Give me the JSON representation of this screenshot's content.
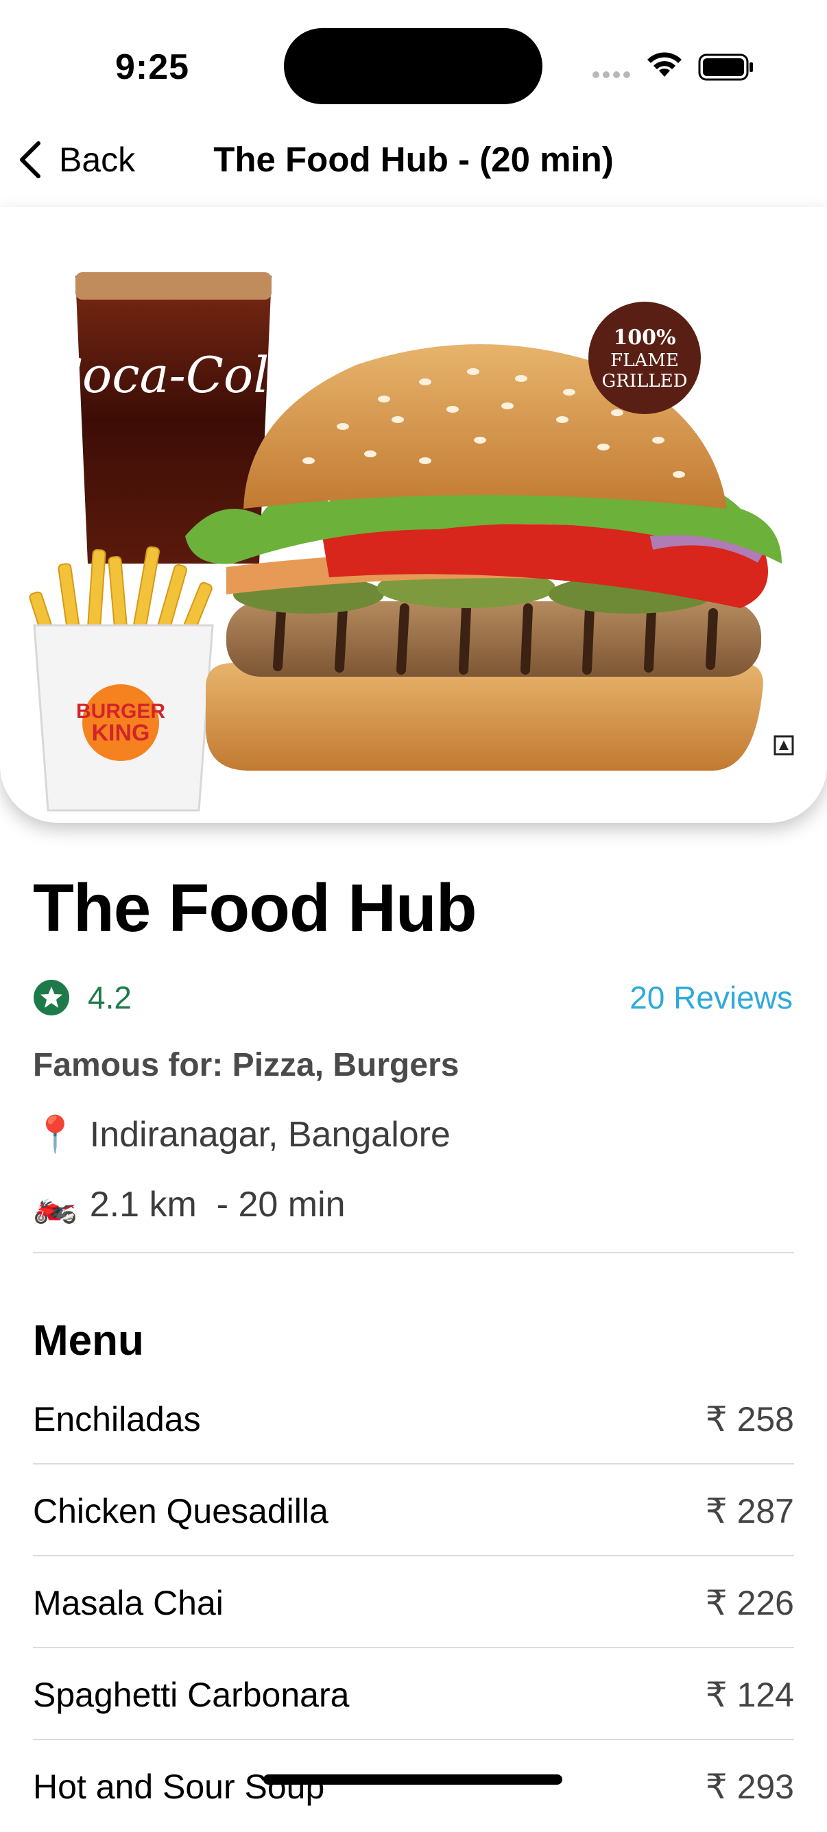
{
  "status_bar": {
    "time": "9:25"
  },
  "nav": {
    "back_label": "Back",
    "title": "The Food Hub - (20 min)"
  },
  "hero": {
    "cola_text": "Coca-Cola",
    "badge_line1": "100%",
    "badge_line2": "FLAME",
    "badge_line3": "GRILLED",
    "brand_line1": "BURGER",
    "brand_line2": "KING"
  },
  "restaurant": {
    "name": "The Food Hub",
    "rating": "4.2",
    "reviews_label": "20 Reviews",
    "famous_for": "Famous for: Pizza, Burgers",
    "location_emoji": "📍",
    "location": "Indiranagar, Bangalore",
    "distance_emoji": "🏍️",
    "distance": "2.1 km  - 20 min"
  },
  "menu": {
    "heading": "Menu",
    "items": [
      {
        "name": "Enchiladas",
        "price": "₹ 258"
      },
      {
        "name": "Chicken Quesadilla",
        "price": "₹ 287"
      },
      {
        "name": "Masala Chai",
        "price": "₹ 226"
      },
      {
        "name": "Spaghetti Carbonara",
        "price": "₹ 124"
      },
      {
        "name": "Hot and Sour Soup",
        "price": "₹ 293"
      }
    ]
  },
  "colors": {
    "rating_green": "#1f7a4a",
    "link_blue": "#2ea9dc",
    "badge_brown": "#5a1f14"
  }
}
